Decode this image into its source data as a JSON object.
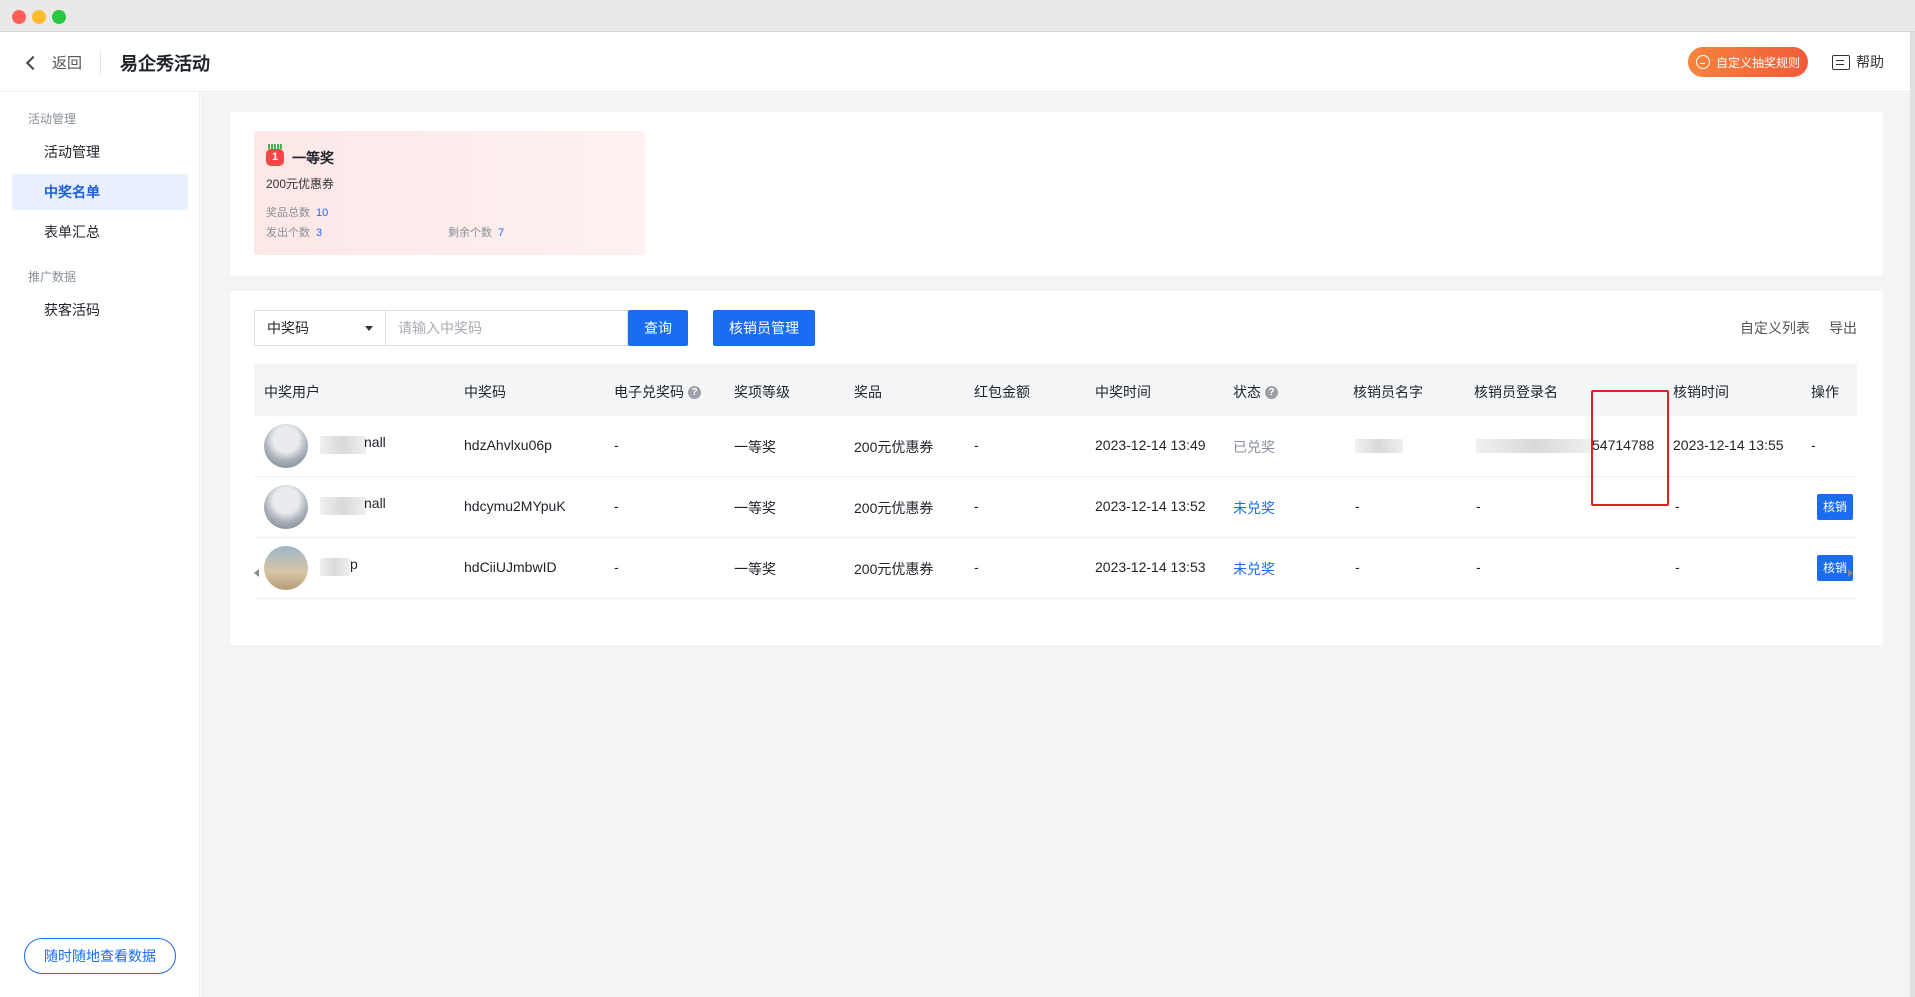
{
  "window": {
    "controls": [
      "close",
      "minimize",
      "maximize"
    ]
  },
  "header": {
    "back_label": "返回",
    "title": "易企秀活动",
    "rule_button": "自定义抽奖规则",
    "help": "帮助"
  },
  "sidebar": {
    "group1": "活动管理",
    "items1": [
      {
        "label": "活动管理",
        "active": false
      },
      {
        "label": "中奖名单",
        "active": true
      },
      {
        "label": "表单汇总",
        "active": false
      }
    ],
    "group2": "推广数据",
    "items2": [
      {
        "label": "获客活码",
        "active": false
      }
    ],
    "bottom_button": "随时随地查看数据"
  },
  "prize": {
    "rank": "1",
    "name": "一等奖",
    "desc": "200元优惠券",
    "total_label": "奖品总数",
    "total": "10",
    "sent_label": "发出个数",
    "sent": "3",
    "remain_label": "剩余个数",
    "remain": "7"
  },
  "toolbar": {
    "select_value": "中奖码",
    "search_placeholder": "请输入中奖码",
    "query_button": "查询",
    "manager_button": "核销员管理",
    "custom_list": "自定义列表",
    "export": "导出"
  },
  "table": {
    "columns": [
      "中奖用户",
      "中奖码",
      "电子兑奖码",
      "奖项等级",
      "奖品",
      "红包金额",
      "中奖时间",
      "状态",
      "核销员名字",
      "核销员登录名",
      "核销时间",
      "操作"
    ],
    "rows": [
      {
        "user": "nall",
        "code": "hdzAhvlxu06p",
        "ecode": "-",
        "level": "一等奖",
        "prize": "200元优惠券",
        "amount": "-",
        "time": "2023-12-14 13:49",
        "status": "已兑奖",
        "staff_name": "",
        "staff_login": "54714788",
        "verify_time": "2023-12-14 13:55",
        "op": "-"
      },
      {
        "user": "nall",
        "code": "hdcymu2MYpuK",
        "ecode": "-",
        "level": "一等奖",
        "prize": "200元优惠券",
        "amount": "-",
        "time": "2023-12-14 13:52",
        "status": "未兑奖",
        "staff_name": "-",
        "staff_login": "-",
        "verify_time": "-",
        "op": "核销"
      },
      {
        "user": "p",
        "code": "hdCiiUJmbwID",
        "ecode": "-",
        "level": "一等奖",
        "prize": "200元优惠券",
        "amount": "-",
        "time": "2023-12-14 13:53",
        "status": "未兑奖",
        "staff_name": "-",
        "staff_login": "-",
        "verify_time": "-",
        "op": "核销"
      }
    ]
  },
  "colors": {
    "primary": "#1a6cf0",
    "highlight": "#e02020",
    "rule_gradient_start": "#f6843c"
  }
}
